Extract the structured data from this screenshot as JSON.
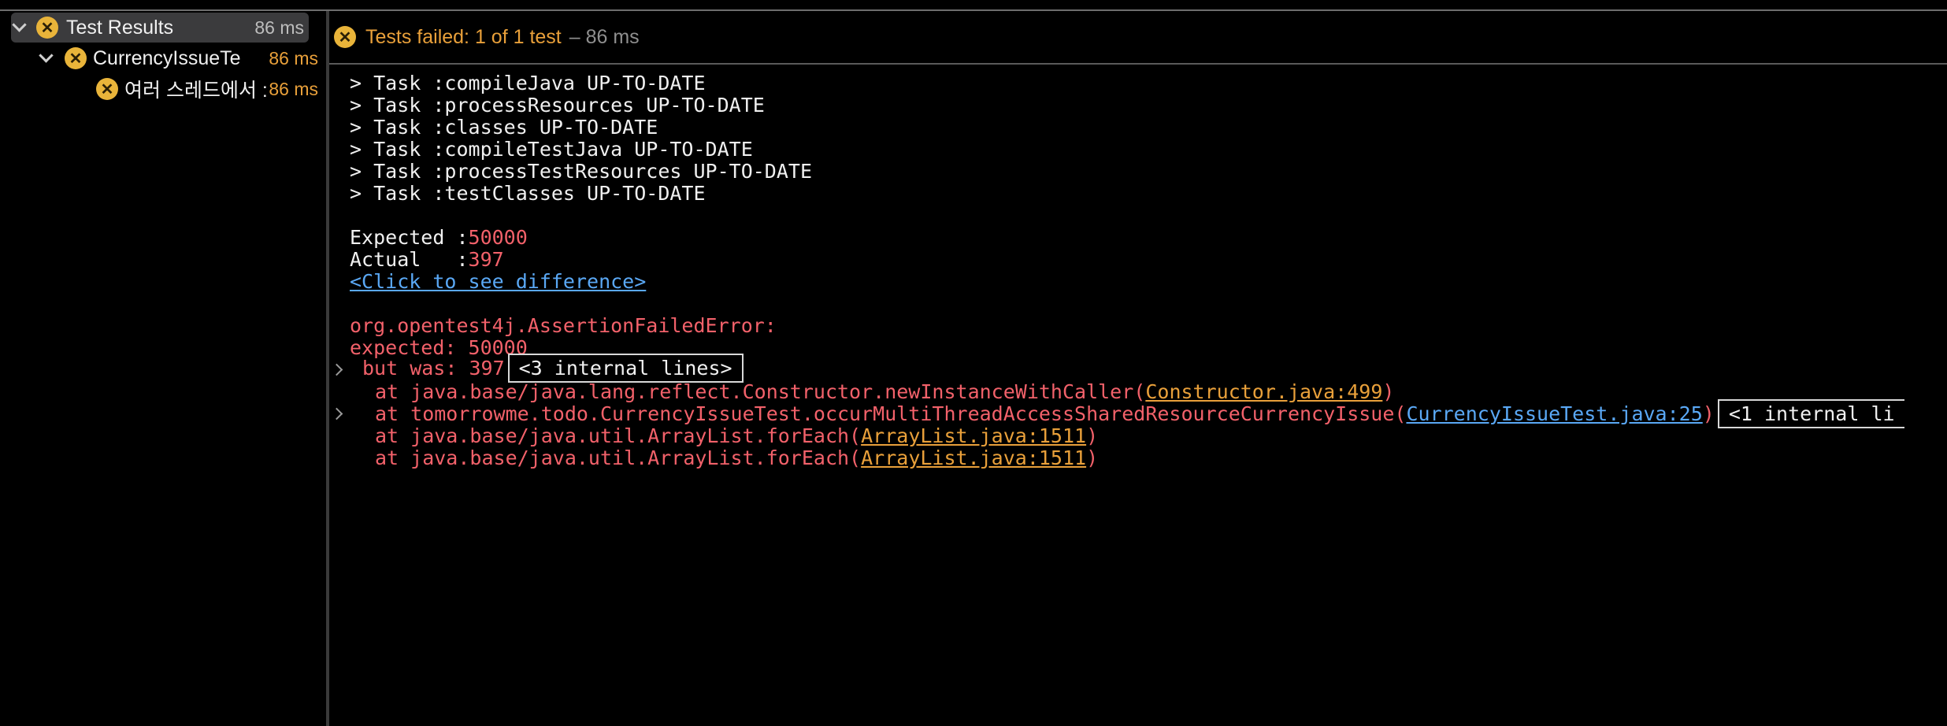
{
  "tree": {
    "items": [
      {
        "label": "Test Results",
        "time": "86 ms"
      },
      {
        "label": "CurrencyIssueTe",
        "time": "86 ms"
      },
      {
        "label": "여러 스레드에서 :",
        "time": "86 ms"
      }
    ]
  },
  "status": {
    "failed_text": "Tests failed: 1 of 1 test",
    "duration": "– 86 ms"
  },
  "console": {
    "tasks": [
      "> Task :compileJava UP-TO-DATE",
      "> Task :processResources UP-TO-DATE",
      "> Task :classes UP-TO-DATE",
      "> Task :compileTestJava UP-TO-DATE",
      "> Task :processTestResources UP-TO-DATE",
      "> Task :testClasses UP-TO-DATE"
    ],
    "expected_label": "Expected :",
    "expected_value": "50000",
    "actual_label": "Actual   :",
    "actual_value": "397",
    "diff_link": "<Click to see difference>",
    "error_class": "org.opentest4j.AssertionFailedError:",
    "expected_line": "expected: 50000",
    "but_was": "but was: 397",
    "internal_lines_3": "<3 internal lines>",
    "stack": [
      {
        "prefix": "at java.base/java.lang.reflect.Constructor.newInstanceWithCaller(",
        "link": "Constructor.java:499",
        "suffix": ")"
      },
      {
        "prefix": "at tomorrowme.todo.CurrencyIssueTest.occurMultiThreadAccessSharedResourceCurrencyIssue(",
        "link": "CurrencyIssueTest.java:25",
        "suffix": ")",
        "internal": "<1 internal li"
      },
      {
        "prefix": "at java.base/java.util.ArrayList.forEach(",
        "link": "ArrayList.java:1511",
        "suffix": ")"
      },
      {
        "prefix": "at java.base/java.util.ArrayList.forEach(",
        "link": "ArrayList.java:1511",
        "suffix": ")"
      }
    ]
  },
  "colors": {
    "fail": "#e9a03a",
    "error": "#f2616a",
    "link": "#5aa8f5"
  },
  "icons": [
    "chevron-down-icon",
    "failed-test-icon",
    "expand-arrow-icon"
  ]
}
